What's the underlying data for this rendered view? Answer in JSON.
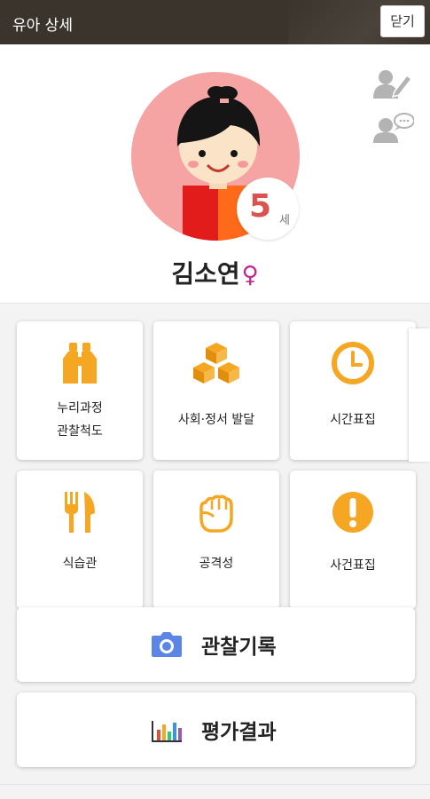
{
  "header": {
    "title": "유아 상세",
    "close_label": "닫기"
  },
  "profile": {
    "name": "김소연",
    "gender_symbol": "♀",
    "age_number": "5",
    "age_unit": "세"
  },
  "tiles": [
    {
      "label_line1": "누리과정",
      "label_line2": "관찰척도",
      "icon": "binoculars-icon"
    },
    {
      "label_line1": "사회·정서 발달",
      "icon": "blocks-icon"
    },
    {
      "label_line1": "시간표집",
      "icon": "clock-icon"
    },
    {
      "label_line1": "식습관",
      "icon": "fork-knife-icon"
    },
    {
      "label_line1": "공격성",
      "icon": "fist-icon"
    },
    {
      "label_line1": "사건표집",
      "icon": "exclamation-icon"
    }
  ],
  "actions": {
    "observation_label": "관찰기록",
    "results_label": "평가결과"
  },
  "colors": {
    "header_bg": "#3b342d",
    "accent": "#f5a623",
    "avatar_bg": "#f6a3a3",
    "age_number": "#d9534f",
    "camera": "#5b86e5",
    "female": "#c2278f"
  }
}
